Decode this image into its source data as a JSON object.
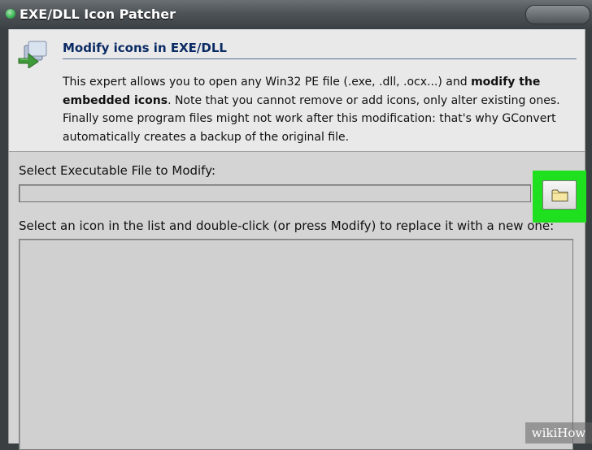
{
  "window": {
    "title": "EXE/DLL Icon Patcher"
  },
  "header": {
    "title": "Modify icons in EXE/DLL",
    "description": {
      "part1": "This expert allows you to open any Win32 PE file (.exe, .dll, .ocx...) and ",
      "bold1": "modify the embedded icons",
      "part2": ". Note that you cannot remove or add icons, only alter existing ones. Finally some program files might not work after this modification: that's why GConvert automatically creates a backup of the original file."
    },
    "icon": "wizard-arrow-icon"
  },
  "executable": {
    "label": "Select Executable File to Modify:",
    "value": "",
    "browse_icon": "folder-icon",
    "highlight_color": "#1fe01f"
  },
  "icon_list": {
    "label": "Select an icon in the list and double-click (or press Modify) to replace it with a new one:"
  },
  "watermark": {
    "text": "wikiHow"
  }
}
